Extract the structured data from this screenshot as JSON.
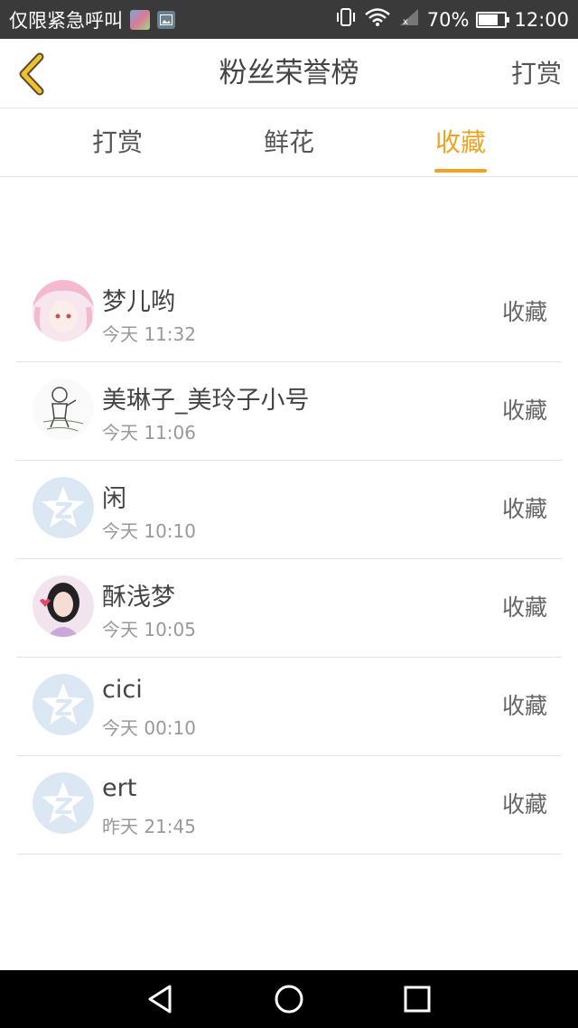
{
  "status_bar": {
    "carrier": "仅限紧急呼叫",
    "battery": "70%",
    "time": "12:00"
  },
  "nav": {
    "title": "粉丝荣誉榜",
    "action": "打赏"
  },
  "tabs": [
    {
      "label": "打赏",
      "active": false
    },
    {
      "label": "鲜花",
      "active": false
    },
    {
      "label": "收藏",
      "active": true
    }
  ],
  "accent_color": "#f0a323",
  "list": [
    {
      "name": "梦儿哟",
      "time": "今天 11:32",
      "action": "收藏",
      "avatar": "anime-girl"
    },
    {
      "name": "美琳子_美玲子小号",
      "time": "今天 11:06",
      "action": "收藏",
      "avatar": "sketch-drawing"
    },
    {
      "name": "闲",
      "time": "今天 10:10",
      "action": "收藏",
      "avatar": "default-z"
    },
    {
      "name": "酥浅梦",
      "time": "今天 10:05",
      "action": "收藏",
      "avatar": "girl-photo"
    },
    {
      "name": "cici",
      "time": "今天 00:10",
      "action": "收藏",
      "avatar": "default-z"
    },
    {
      "name": "ert",
      "time": "昨天 21:45",
      "action": "收藏",
      "avatar": "default-z"
    }
  ]
}
